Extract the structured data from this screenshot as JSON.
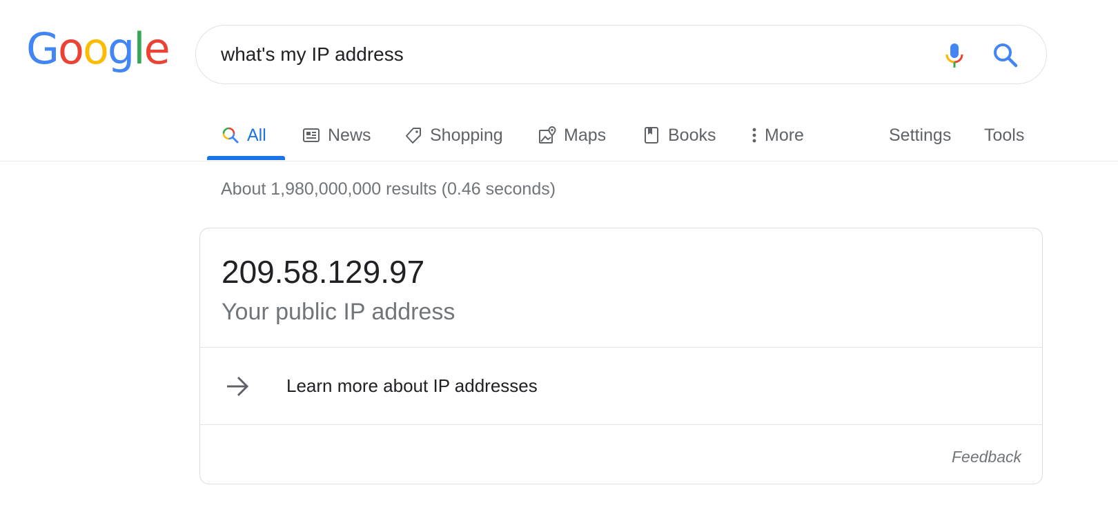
{
  "logo": {
    "letters": [
      "G",
      "o",
      "o",
      "g",
      "l",
      "e"
    ],
    "colors": [
      "#4285F4",
      "#EA4335",
      "#FBBC05",
      "#4285F4",
      "#34A853",
      "#EA4335"
    ]
  },
  "search": {
    "value": "what's my IP address"
  },
  "tabs": [
    {
      "label": "All",
      "icon": "search-icon",
      "active": true
    },
    {
      "label": "News",
      "icon": "news-icon"
    },
    {
      "label": "Shopping",
      "icon": "tag-icon"
    },
    {
      "label": "Maps",
      "icon": "map-icon"
    },
    {
      "label": "Books",
      "icon": "book-icon"
    },
    {
      "label": "More",
      "icon": "more-vert-icon"
    },
    {
      "label": "Settings"
    },
    {
      "label": "Tools"
    }
  ],
  "results": {
    "stats": "About 1,980,000,000 results (0.46 seconds)"
  },
  "answer": {
    "ip": "209.58.129.97",
    "caption": "Your public IP address",
    "learn_more": "Learn more about IP addresses",
    "feedback": "Feedback"
  },
  "colors": {
    "accent": "#1a73e8",
    "text": "#202124",
    "muted": "#70757a"
  }
}
